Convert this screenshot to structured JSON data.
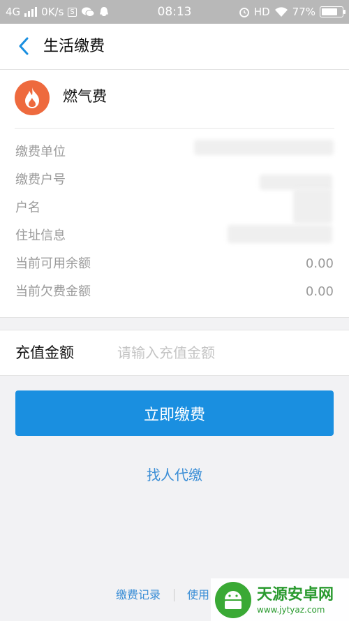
{
  "status_bar": {
    "network": "4G",
    "speed": "0K/s",
    "time": "08:13",
    "hd": "HD",
    "battery": "77%"
  },
  "nav": {
    "back_icon": "chevron-left-icon",
    "title": "生活缴费"
  },
  "biller": {
    "icon": "flame-icon",
    "icon_color": "#ee6a3e",
    "name": "燃气费"
  },
  "info_rows": [
    {
      "label": "缴费单位",
      "value": ""
    },
    {
      "label": "缴费户号",
      "value": ""
    },
    {
      "label": "户名",
      "value": ""
    },
    {
      "label": "住址信息",
      "value": ""
    },
    {
      "label": "当前可用余额",
      "value": "0.00"
    },
    {
      "label": "当前欠费金额",
      "value": "0.00"
    }
  ],
  "recharge": {
    "label": "充值金额",
    "placeholder": "请输入充值金额",
    "value": ""
  },
  "pay_button": {
    "label": "立即缴费",
    "color": "#1a8fe0"
  },
  "proxy_link": "找人代缴",
  "footer": {
    "records_label": "缴费记录",
    "help_label": "使用"
  },
  "watermark": {
    "name": "天源安卓网",
    "url": "www.jytyaz.com"
  }
}
